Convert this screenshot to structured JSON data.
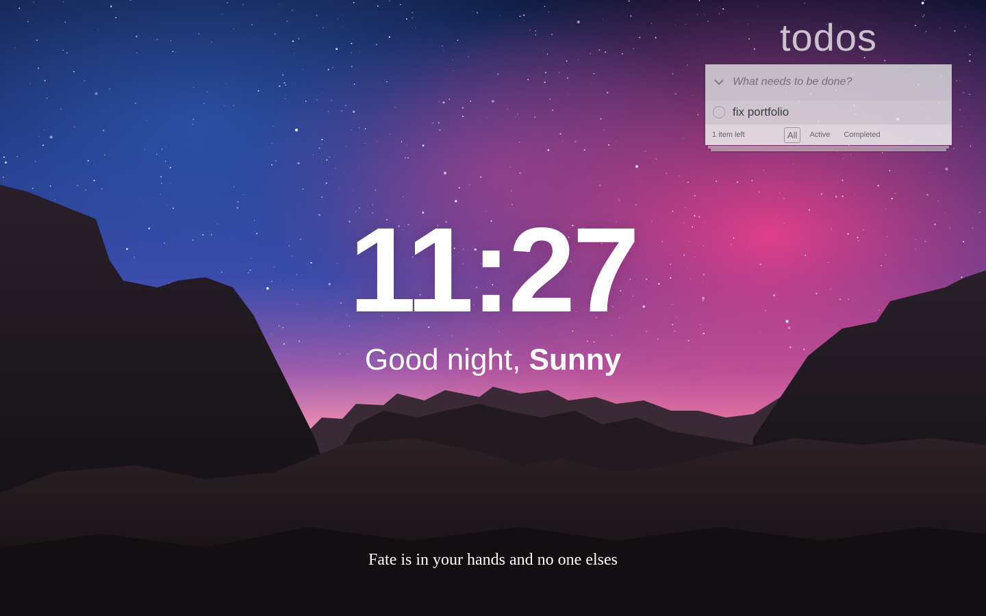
{
  "todos": {
    "title": "todos",
    "new_todo_placeholder": "What needs to be done?",
    "toggle_all_icon": "chevron-down-icon",
    "items": [
      {
        "label": "fix portfolio",
        "completed": false
      }
    ],
    "footer": {
      "count": "1",
      "count_suffix": "item left",
      "filters": [
        {
          "label": "All",
          "selected": true
        },
        {
          "label": "Active",
          "selected": false
        },
        {
          "label": "Completed",
          "selected": false
        }
      ]
    }
  },
  "clock": {
    "time": "11:27"
  },
  "greeting": {
    "prefix": "Good night,",
    "name": "Sunny"
  },
  "quote": {
    "text": "Fate is in your hands and no one elses"
  },
  "colors": {
    "sky_top": "#0b1436",
    "sky_mid": "#2b3f8f",
    "glow_pink": "#e0508a",
    "horizon": "#f2a0b8",
    "rocks": "#1a1418"
  }
}
